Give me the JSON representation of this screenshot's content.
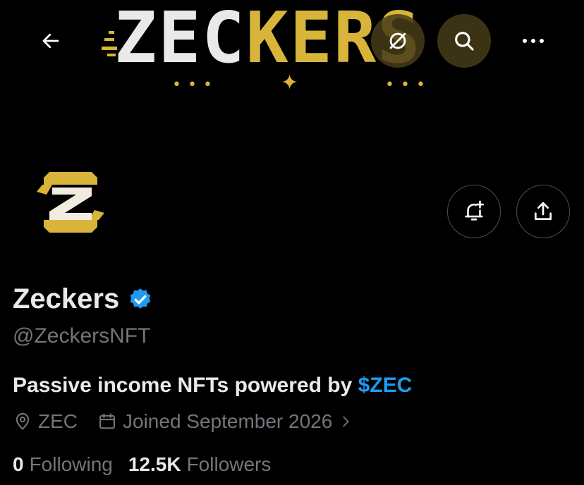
{
  "banner": {
    "word_light": "ZEC",
    "word_gold": "KERS",
    "dots": "• • •"
  },
  "profile": {
    "display_name": "Zeckers",
    "handle": "@ZeckersNFT",
    "bio_text": "Passive income NFTs powered by ",
    "bio_link": "$ZEC",
    "location": "ZEC",
    "joined": "Joined September 2026",
    "following_count": "0",
    "following_label": "Following",
    "followers_count": "12.5K",
    "followers_label": "Followers"
  },
  "icons": {
    "back": "arrow-left-icon",
    "grok": "grok-icon",
    "search": "search-icon",
    "more": "more-icon",
    "notify": "bell-plus-icon",
    "share": "share-icon",
    "verified": "verified-badge-icon",
    "location": "location-pin-icon",
    "calendar": "calendar-icon",
    "chevron": "chevron-right-icon"
  },
  "colors": {
    "background": "#000000",
    "gold": "#d8b43a",
    "link": "#1d9bf0",
    "secondary_text": "#71767b",
    "primary_text": "#e7e9ea"
  }
}
